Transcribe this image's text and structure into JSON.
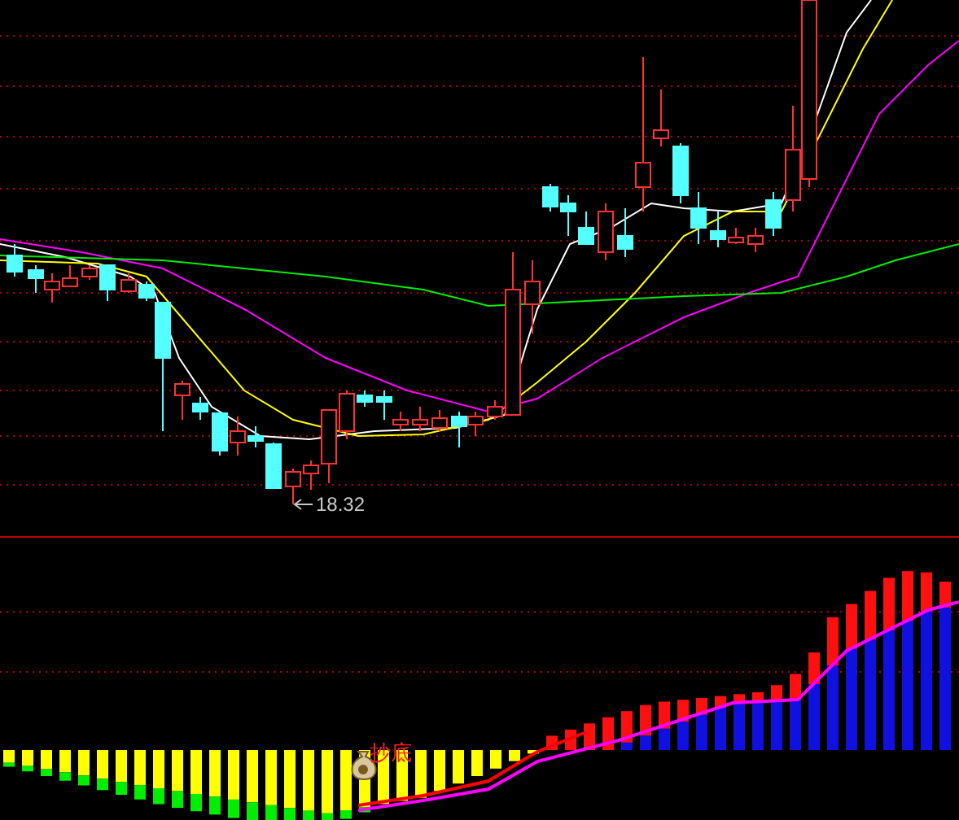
{
  "price_chart": {
    "low_marker": {
      "label": "18.32"
    }
  },
  "indicator_chart": {
    "signal": {
      "label": "抄底"
    }
  }
}
